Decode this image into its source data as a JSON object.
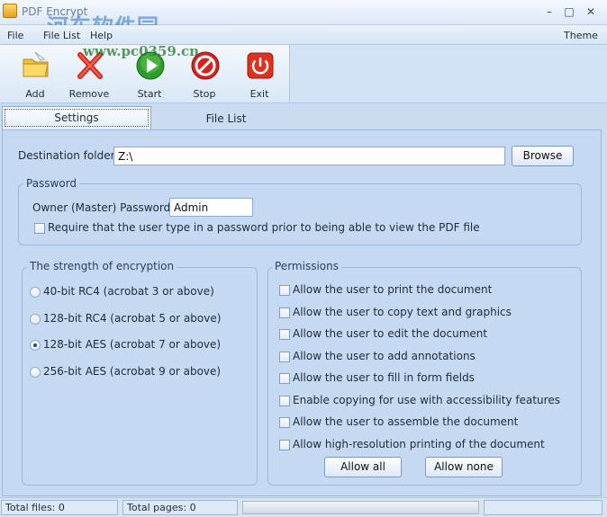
{
  "window": {
    "title": "PDF Encrypt",
    "watermark_cn": "河东软件园",
    "watermark_url": "www.pc0359.cn",
    "min_glyph": "–",
    "max_glyph": "□",
    "close_glyph": "✕"
  },
  "menu": {
    "items": [
      "File",
      "File List",
      "Help"
    ],
    "theme": "Theme"
  },
  "toolbar": {
    "buttons": [
      {
        "label": "Add",
        "icon": "folder-icon"
      },
      {
        "label": "Remove",
        "icon": "remove-x-icon"
      },
      {
        "label": "Start",
        "icon": "play-icon"
      },
      {
        "label": "Stop",
        "icon": "stop-icon"
      },
      {
        "label": "Exit",
        "icon": "power-icon"
      }
    ]
  },
  "tabs": {
    "settings": "Settings",
    "file_list": "File List"
  },
  "settings": {
    "destination_label": "Destination folder:",
    "destination_value": "Z:\\",
    "browse": "Browse",
    "password_group": "Password",
    "owner_label": "Owner (Master) Password:",
    "owner_value": "Admin",
    "require_user_pw": "Require that the user type in a password prior to being able to view the PDF file",
    "strength_group": "The strength of encryption",
    "strength_options": [
      {
        "label": "40-bit RC4 (acrobat 3 or above)",
        "selected": false
      },
      {
        "label": "128-bit RC4 (acrobat 5 or above)",
        "selected": false
      },
      {
        "label": "128-bit AES (acrobat 7 or above)",
        "selected": true
      },
      {
        "label": "256-bit AES (acrobat 9 or above)",
        "selected": false
      }
    ],
    "permissions_group": "Permissions",
    "permissions": [
      "Allow the user to print the document",
      "Allow the user to copy text and graphics",
      "Allow the user to edit the document",
      "Allow the user to add annotations",
      "Allow the user to fill in form fields",
      "Enable copying for use with accessibility features",
      "Allow the user to assemble the document",
      "Allow high-resolution printing of the document"
    ],
    "allow_all": "Allow all",
    "allow_none": "Allow none"
  },
  "status": {
    "total_files": "Total files: 0",
    "total_pages": "Total pages: 0"
  },
  "colors": {
    "panel_bg": "#c5daf2",
    "play_green": "#2f9b2a",
    "stop_red": "#d8231d",
    "exit_red": "#e0301e"
  }
}
